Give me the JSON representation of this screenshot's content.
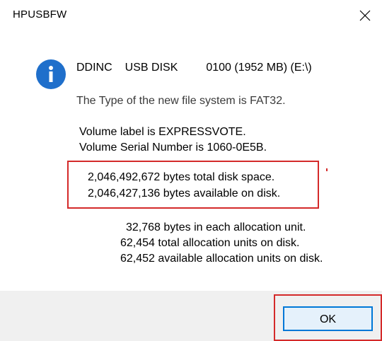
{
  "window": {
    "title": "HPUSBFW",
    "close_glyph": "close-icon"
  },
  "message": {
    "icon": "info-icon",
    "drive": {
      "vendor": "DDINC",
      "model": "USB DISK",
      "info": "0100 (1952 MB) (E:\\)"
    },
    "filesystem": "The Type of the new file system is FAT32.",
    "volume_label": "Volume label is EXPRESSVOTE.",
    "volume_serial": "Volume Serial Number is 1060-0E5B.",
    "total_space": "2,046,492,672 bytes total disk space.",
    "available_space": "2,046,427,136 bytes available on disk.",
    "allocation_unit_size": "32,768 bytes in each allocation unit.",
    "total_allocation_units": "62,454 total allocation units on disk.",
    "available_allocation_units": "62,452 available allocation units on disk."
  },
  "buttons": {
    "ok_label": "OK"
  },
  "colors": {
    "accent": "#0078d7",
    "info_icon": "#1f6fcb",
    "highlight": "#d42a2a",
    "footer_bg": "#f0f0f0"
  }
}
